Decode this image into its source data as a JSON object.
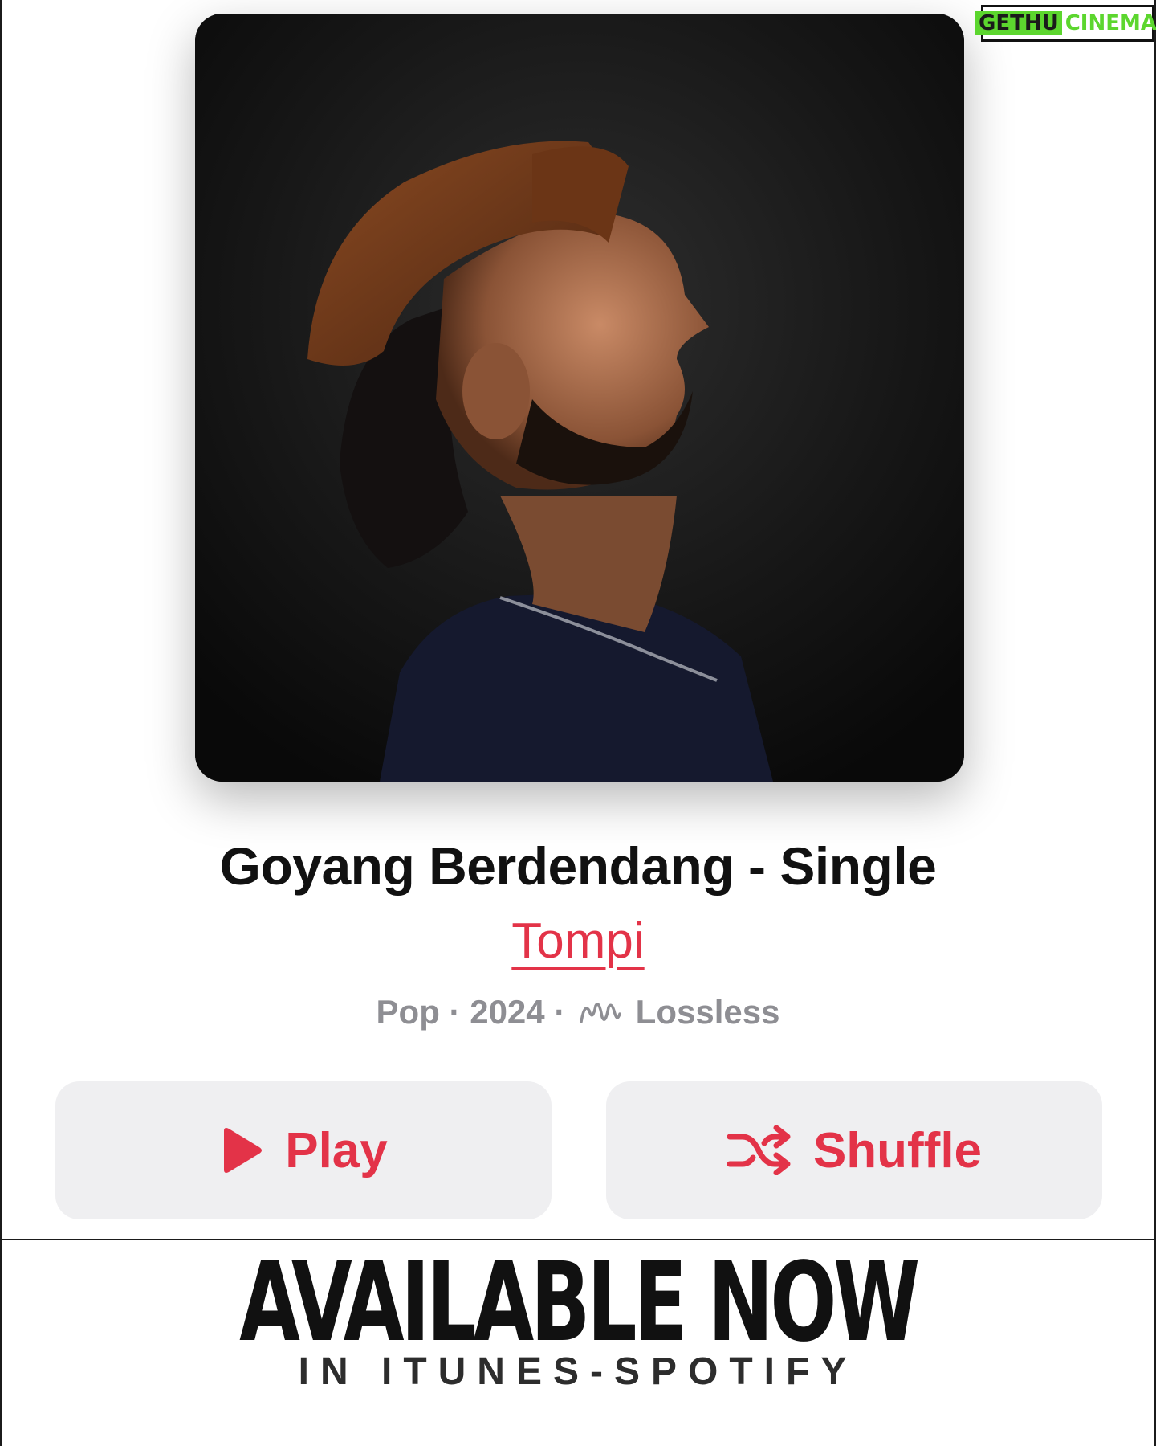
{
  "watermark": {
    "part1": "GETHU",
    "part2": "CINEMA"
  },
  "album": {
    "title": "Goyang Berdendang - Single",
    "artist": "Tompi",
    "genre": "Pop",
    "year": "2024",
    "quality": "Lossless",
    "separator": "·"
  },
  "actions": {
    "play_label": "Play",
    "shuffle_label": "Shuffle"
  },
  "promo": {
    "headline": "AVAILABLE NOW",
    "subline": "IN ITUNES-SPOTIFY"
  },
  "colors": {
    "accent": "#e33348",
    "button_bg": "#efeff1",
    "meta_text": "#8e8e93"
  },
  "icons": {
    "play": "play-icon",
    "shuffle": "shuffle-icon",
    "lossless": "lossless-icon"
  }
}
